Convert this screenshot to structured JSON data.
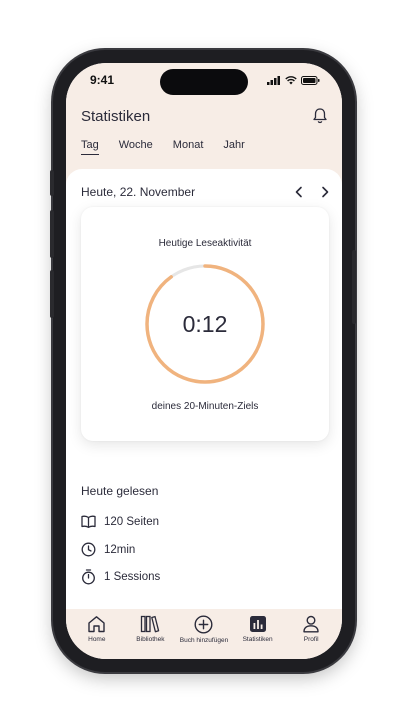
{
  "status_bar": {
    "time": "9:41"
  },
  "header": {
    "title": "Statistiken"
  },
  "tabs": [
    {
      "label": "Tag",
      "active": true
    },
    {
      "label": "Woche",
      "active": false
    },
    {
      "label": "Monat",
      "active": false
    },
    {
      "label": "Jahr",
      "active": false
    }
  ],
  "date": {
    "label": "Heute, 22. November"
  },
  "activity_card": {
    "title": "Heutige Leseaktivität",
    "value": "0:12",
    "subtitle": "deines 20-Minuten-Ziels",
    "progress": 0.9,
    "progress_color": "#f0b37e",
    "track_color": "#e6e6e6"
  },
  "today_read": {
    "title": "Heute gelesen",
    "items": [
      {
        "icon": "open-book-icon",
        "text": "120 Seiten"
      },
      {
        "icon": "clock-icon",
        "text": "12min"
      },
      {
        "icon": "stopwatch-icon",
        "text": "1 Sessions"
      }
    ]
  },
  "bottom_nav": {
    "items": [
      {
        "icon": "home-icon",
        "label": "Home"
      },
      {
        "icon": "library-icon",
        "label": "Bibliothek"
      },
      {
        "icon": "add-circle-icon",
        "label": "Buch hinzufügen"
      },
      {
        "icon": "stats-icon",
        "label": "Statistiken",
        "active": true
      },
      {
        "icon": "profile-icon",
        "label": "Profil"
      }
    ]
  },
  "colors": {
    "header_bg": "#f7ede6",
    "text": "#2b2b3a",
    "accent": "#f0b37e"
  }
}
